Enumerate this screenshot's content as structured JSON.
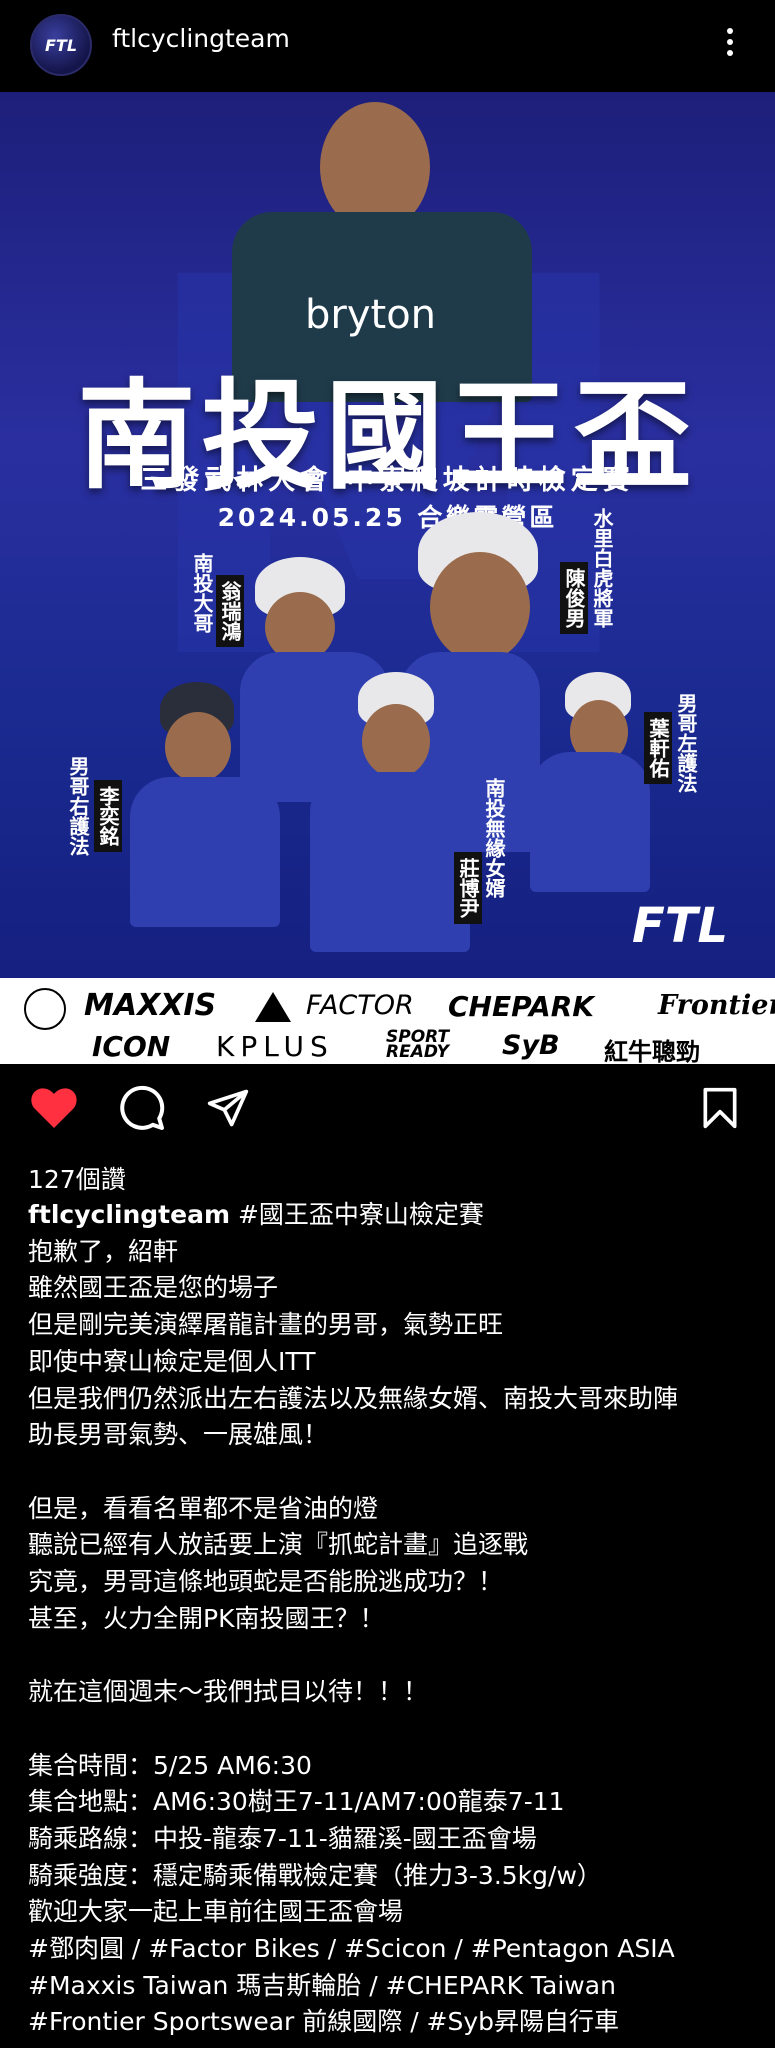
{
  "header": {
    "avatar_text": "FTL",
    "username": "ftlcyclingteam"
  },
  "poster": {
    "title": "南投國王盃",
    "subtitle": "三發武林大會 中寮爬坡計時檢定賽",
    "date": "2024.05.25 合樂露營區",
    "jersey_brand": "bryton",
    "riders": [
      {
        "role": "南投大哥",
        "name": "翁瑞鴻"
      },
      {
        "role": "水里白虎將軍",
        "name": "陳俊男"
      },
      {
        "role": "男哥左護法",
        "name": "葉軒佑"
      },
      {
        "role": "男哥右護法",
        "name": "李奕銘"
      },
      {
        "role": "南投無緣女婿",
        "name": "莊博尹"
      }
    ],
    "logo": "FTL"
  },
  "sponsors": [
    "MAXXIS",
    "FACTOR",
    "CHEPARK",
    "Frontier",
    "ICON",
    "KPLUS",
    "SPORT READY",
    "SyB",
    "紅牛聰勁"
  ],
  "actions": {
    "like_icon": "heart-icon",
    "comment_icon": "comment-icon",
    "share_icon": "send-icon",
    "save_icon": "bookmark-icon"
  },
  "likes": "127個讚",
  "caption": {
    "username": "ftlcyclingteam",
    "first_line": " #國王盃中寮山檢定賽",
    "lines": [
      "抱歉了，紹軒",
      "雖然國王盃是您的場子",
      "但是剛完美演繹屠龍計畫的男哥，氣勢正旺",
      "即使中寮山檢定是個人ITT",
      "但是我們仍然派出左右護法以及無緣女婿、南投大哥來助陣",
      "助長男哥氣勢、一展雄風！",
      "",
      "但是，看看名單都不是省油的燈",
      "聽說已經有人放話要上演『抓蛇計畫』追逐戰",
      "究竟，男哥這條地頭蛇是否能脫逃成功？！",
      "甚至，火力全開PK南投國王？！",
      "",
      "就在這個週末～我們拭目以待！！！",
      "",
      "集合時間：5/25 AM6:30",
      "集合地點：AM6:30樹王7-11/AM7:00龍泰7-11",
      "騎乘路線：中投-龍泰7-11-貓羅溪-國王盃會場",
      "騎乘強度：穩定騎乘備戰檢定賽（推力3-3.5kg/w）",
      "歡迎大家一起上車前往國王盃會場",
      "#鄧肉圓 / #Factor Bikes / #Scicon / #Pentagon ASIA",
      "#Maxxis Taiwan 瑪吉斯輪胎 / #CHEPARK Taiwan",
      "#Frontier Sportswear 前線國際 / #Syb昇陽自行車"
    ]
  }
}
